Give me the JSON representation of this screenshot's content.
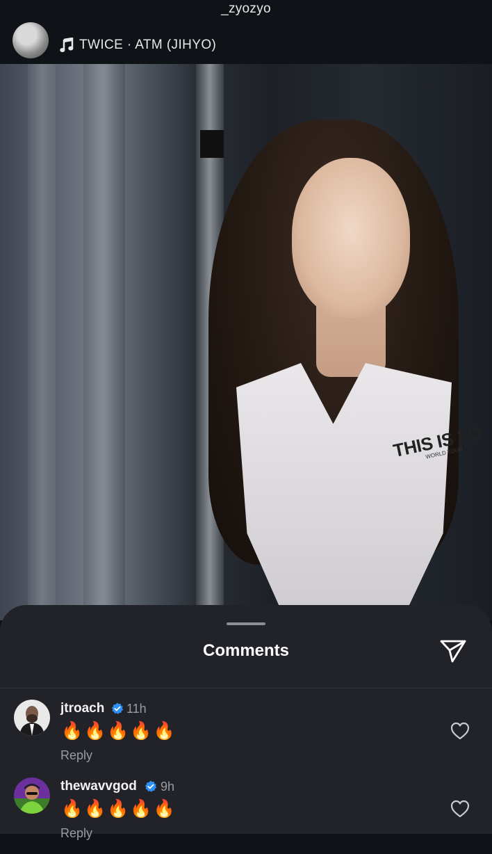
{
  "header": {
    "username": "_zyozyo"
  },
  "post": {
    "song": "TWICE · ATM (JIHYO)",
    "shirt_text": "THIS IS FO",
    "shirt_subtext": "WORLD TOUR"
  },
  "comments_sheet": {
    "title": "Comments",
    "comments": [
      {
        "user": "jtroach",
        "time": "11h",
        "text": "🔥🔥🔥🔥🔥",
        "reply_label": "Reply"
      },
      {
        "user": "thewavvgod",
        "time": "9h",
        "text": "🔥🔥🔥🔥🔥",
        "reply_label": "Reply"
      }
    ]
  },
  "colors": {
    "verified": "#2f8ff7",
    "sheet_bg": "#212328",
    "page_bg": "#0f1216"
  }
}
